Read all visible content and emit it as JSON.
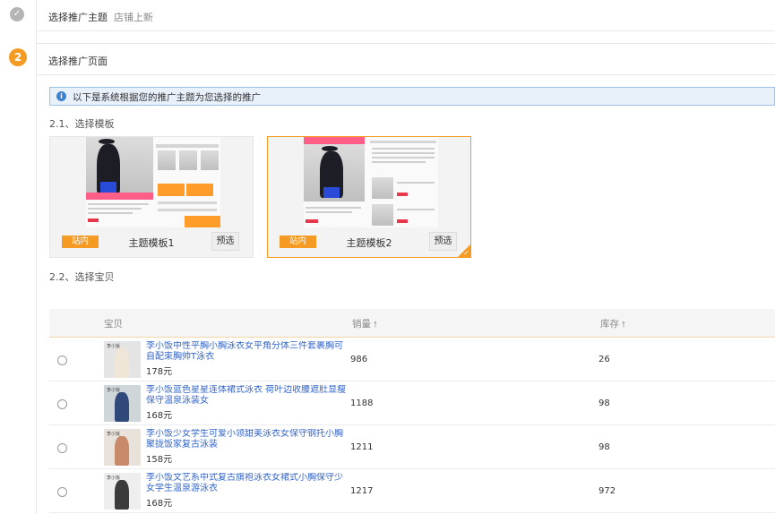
{
  "step1": {
    "title": "选择推广主题",
    "subtitle": "店铺上新",
    "icon": "check-icon"
  },
  "step2": {
    "number": "2",
    "title": "选择推广页面"
  },
  "notice": {
    "text": "以下是系统根据您的推广主题为您选择的推广",
    "icon": "info-icon"
  },
  "section_templates": {
    "title": "2.1、选择模板"
  },
  "templates": [
    {
      "tag": "站内",
      "name": "主题模板1",
      "preview_label": "预选",
      "selected": false
    },
    {
      "tag": "站内",
      "name": "主题模板2",
      "preview_label": "预选",
      "selected": true
    }
  ],
  "section_items": {
    "title": "2.2、选择宝贝"
  },
  "table": {
    "headers": {
      "item": "宝贝",
      "sales": "销量",
      "stock": "库存"
    },
    "rows": [
      {
        "title": "李小饭中性平胸小胸泳衣女平角分体三件套裹胸可自配束胸帅T泳衣",
        "price": "178元",
        "sales": "986",
        "stock": "26"
      },
      {
        "title": "李小饭蓝色星星连体裙式泳衣 荷叶边收腰遮肚显瘦保守温泉泳装女",
        "price": "168元",
        "sales": "1188",
        "stock": "98"
      },
      {
        "title": "李小饭少女学生可爱小领甜美泳衣女保守钢托小胸聚拢饭家复古泳装",
        "price": "158元",
        "sales": "1211",
        "stock": "98"
      },
      {
        "title": "李小饭文艺系中式复古旗袍泳衣女裙式小胸保守少女学生温泉游泳衣",
        "price": "168元",
        "sales": "1217",
        "stock": "972"
      }
    ]
  },
  "colors": {
    "accent": "#f59a23",
    "link": "#3366cc",
    "info": "#3d82d1"
  }
}
